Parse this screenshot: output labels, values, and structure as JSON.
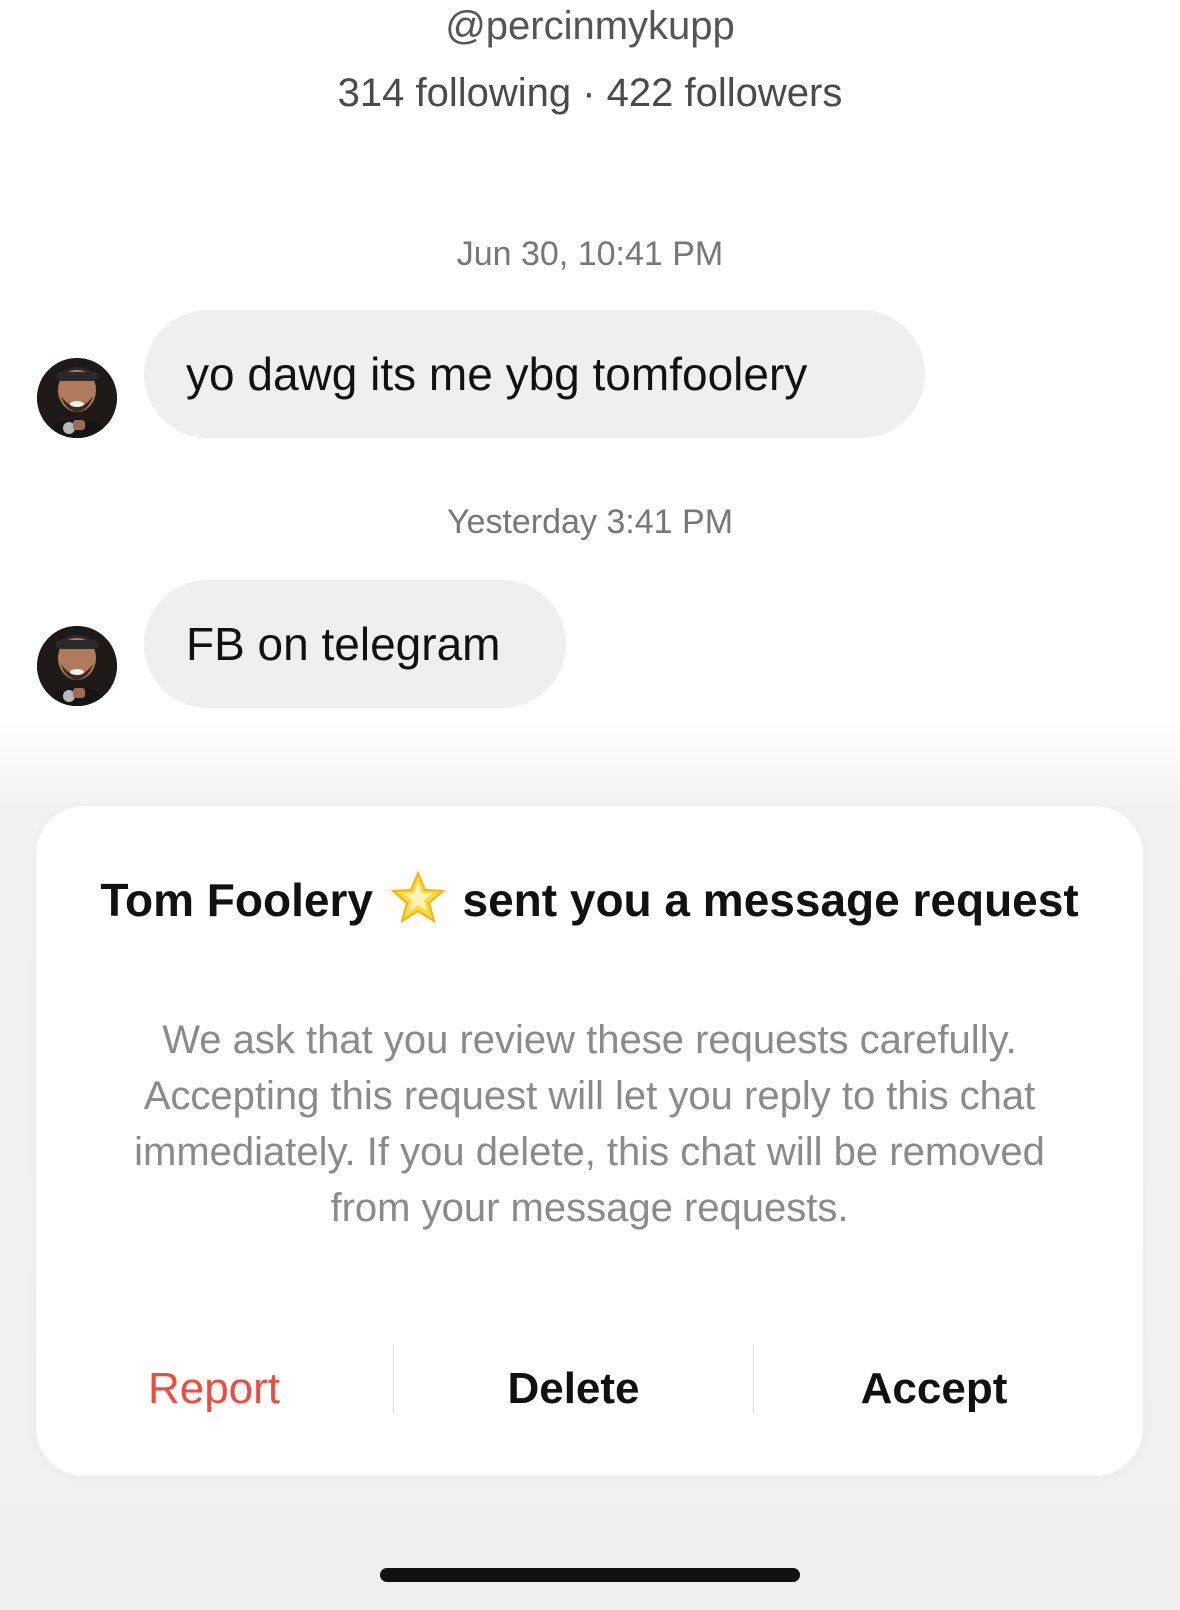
{
  "profile": {
    "handle": "@percinmykupp",
    "stats": "314 following · 422 followers"
  },
  "messages": [
    {
      "timestamp": "Jun 30, 10:41 PM",
      "text": "yo dawg its me ybg tomfoolery",
      "avatar": "sender-avatar"
    },
    {
      "timestamp": "Yesterday 3:41 PM",
      "text": "FB on telegram",
      "avatar": "sender-avatar"
    }
  ],
  "request_card": {
    "sender_name": "Tom Foolery",
    "title_suffix": "sent you a message request",
    "star_icon": "glowing-star-emoji",
    "body": "We ask that you review these requests carefully. Accepting this request will let you reply to this chat immediately. If you delete, this chat will be removed from your message requests.",
    "actions": {
      "report": "Report",
      "delete": "Delete",
      "accept": "Accept"
    }
  },
  "colors": {
    "report": "#ef4b3f",
    "bubble": "#efefef",
    "background_overlay": "#efefef"
  }
}
